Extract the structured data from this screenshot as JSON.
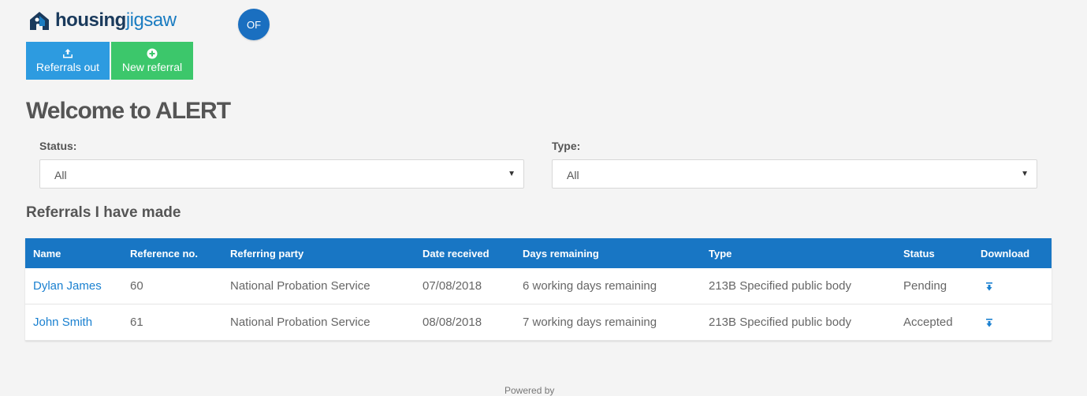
{
  "brand": {
    "housing": "housing",
    "jigsaw": "jigsaw"
  },
  "user": {
    "initials": "OF"
  },
  "nav": {
    "referrals_out": "Referrals out",
    "new_referral": "New referral"
  },
  "page": {
    "title": "Welcome to ALERT"
  },
  "filters": {
    "status": {
      "label": "Status:",
      "value": "All"
    },
    "type": {
      "label": "Type:",
      "value": "All"
    }
  },
  "section": {
    "title": "Referrals I have made"
  },
  "table": {
    "headers": [
      "Name",
      "Reference no.",
      "Referring party",
      "Date received",
      "Days remaining",
      "Type",
      "Status",
      "Download"
    ],
    "rows": [
      [
        "Dylan James",
        "60",
        "National Probation Service",
        "07/08/2018",
        "6 working days remaining",
        "213B Specified public body",
        "Pending"
      ],
      [
        "John Smith",
        "61",
        "National Probation Service",
        "08/08/2018",
        "7 working days remaining",
        "213B Specified public body",
        "Accepted"
      ]
    ]
  },
  "footer": {
    "text": "Powered by"
  },
  "colors": {
    "primary": "#1876c4",
    "referrals_out_bg": "#2d9be0",
    "new_referral_bg": "#3cc76b",
    "link": "#1a80d0"
  },
  "icons": {
    "logo": "house-jigsaw-icon",
    "referrals_out": "upload-tray-icon",
    "new_referral": "plus-circle-icon",
    "download": "download-arrow-icon",
    "select_caret": "caret-down-icon"
  }
}
